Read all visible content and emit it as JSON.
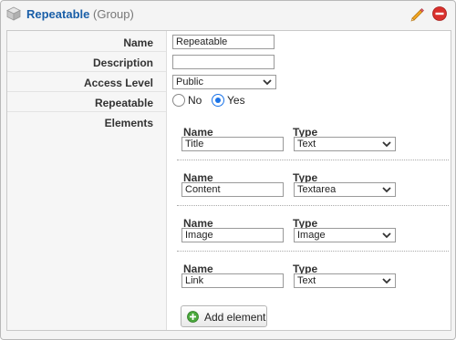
{
  "header": {
    "title": "Repeatable",
    "kind": "(Group)",
    "icons": {
      "type": "cube-icon",
      "edit": "pencil-icon",
      "delete": "delete-icon"
    }
  },
  "form": {
    "labels": {
      "name": "Name",
      "description": "Description",
      "access_level": "Access Level",
      "repeatable": "Repeatable",
      "elements": "Elements"
    },
    "name_value": "Repeatable",
    "description_value": "",
    "access_level_value": "Public",
    "repeatable_options": [
      "No",
      "Yes"
    ],
    "repeatable_selected": "Yes"
  },
  "elements": {
    "name_header": "Name",
    "type_header": "Type",
    "items": [
      {
        "name": "Title",
        "type": "Text"
      },
      {
        "name": "Content",
        "type": "Textarea"
      },
      {
        "name": "Image",
        "type": "Image"
      },
      {
        "name": "Link",
        "type": "Text"
      }
    ],
    "add_label": "Add element"
  },
  "colors": {
    "accent": "#1a5fa8",
    "radio": "#1a73e8",
    "delete": "#d9302c",
    "add": "#4aa83c"
  }
}
